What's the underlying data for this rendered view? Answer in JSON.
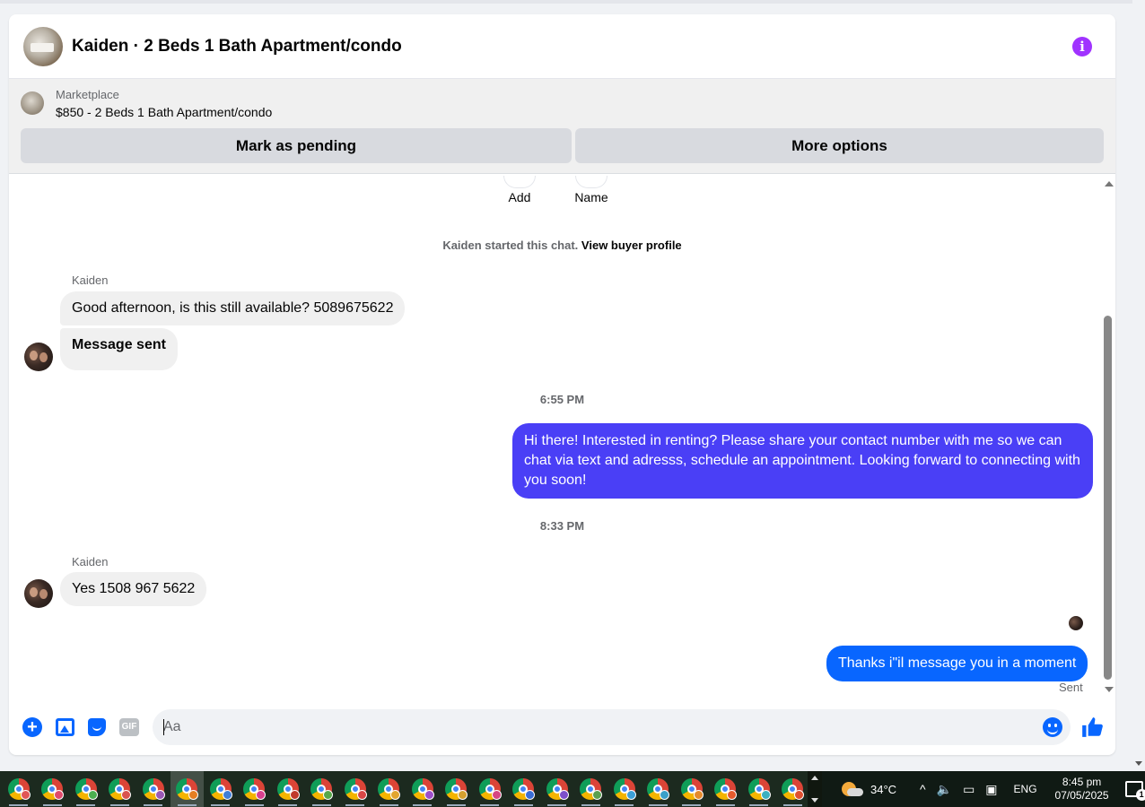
{
  "header": {
    "title": "Kaiden · 2 Beds 1 Bath Apartment/condo"
  },
  "listing": {
    "source": "Marketplace",
    "name": "$850 - 2 Beds 1 Bath Apartment/condo",
    "mark_pending_label": "Mark as pending",
    "more_options_label": "More options"
  },
  "profile_actions": {
    "add_label": "Add",
    "name_label": "Name"
  },
  "conversation": {
    "started_text": "Kaiden started this chat.",
    "view_profile_link": "View buyer profile",
    "sender": "Kaiden",
    "msg1": "Good afternoon, is this still available? 5089675622",
    "msg2": "Message sent",
    "time1": "6:55 PM",
    "msg3": "Hi there! Interested in renting? Please share your contact number with me so we can chat via text and adresss, schedule an appointment. Looking forward to connecting with you soon!",
    "time2": "8:33 PM",
    "msg4": "Yes 1508 967 5622",
    "msg5": "Thanks i\"il message you in a moment",
    "status": "Sent"
  },
  "composer": {
    "placeholder": "Aa",
    "value": "",
    "gif_label": "GIF"
  },
  "colors": {
    "accent_blue": "#0866ff",
    "bubble_purple": "#4a3ff6",
    "info_purple": "#a033ff",
    "incoming_bubble": "#f0f0f0"
  },
  "taskbar": {
    "app_count": 24,
    "badge_colors": [
      "#e05656",
      "#e04b6c",
      "#4caf50",
      "#d9534f",
      "#9b59b6",
      "#e67e22",
      "#3f7fd8",
      "#d9408f",
      "#c0392b",
      "#57a84a",
      "#d94646",
      "#e2a52f",
      "#9c4fc9",
      "#d4a02f",
      "#d64583",
      "#3a6ed6",
      "#7d4fc9",
      "#5aa050",
      "#3c9fd6",
      "#3aa0c8",
      "#e58a2c",
      "#e55a2c",
      "#3ab0c0",
      "#e05030"
    ],
    "temperature": "34°C",
    "language": "ENG",
    "time": "8:45 pm",
    "date": "07/05/2025",
    "notification_count": "1"
  }
}
